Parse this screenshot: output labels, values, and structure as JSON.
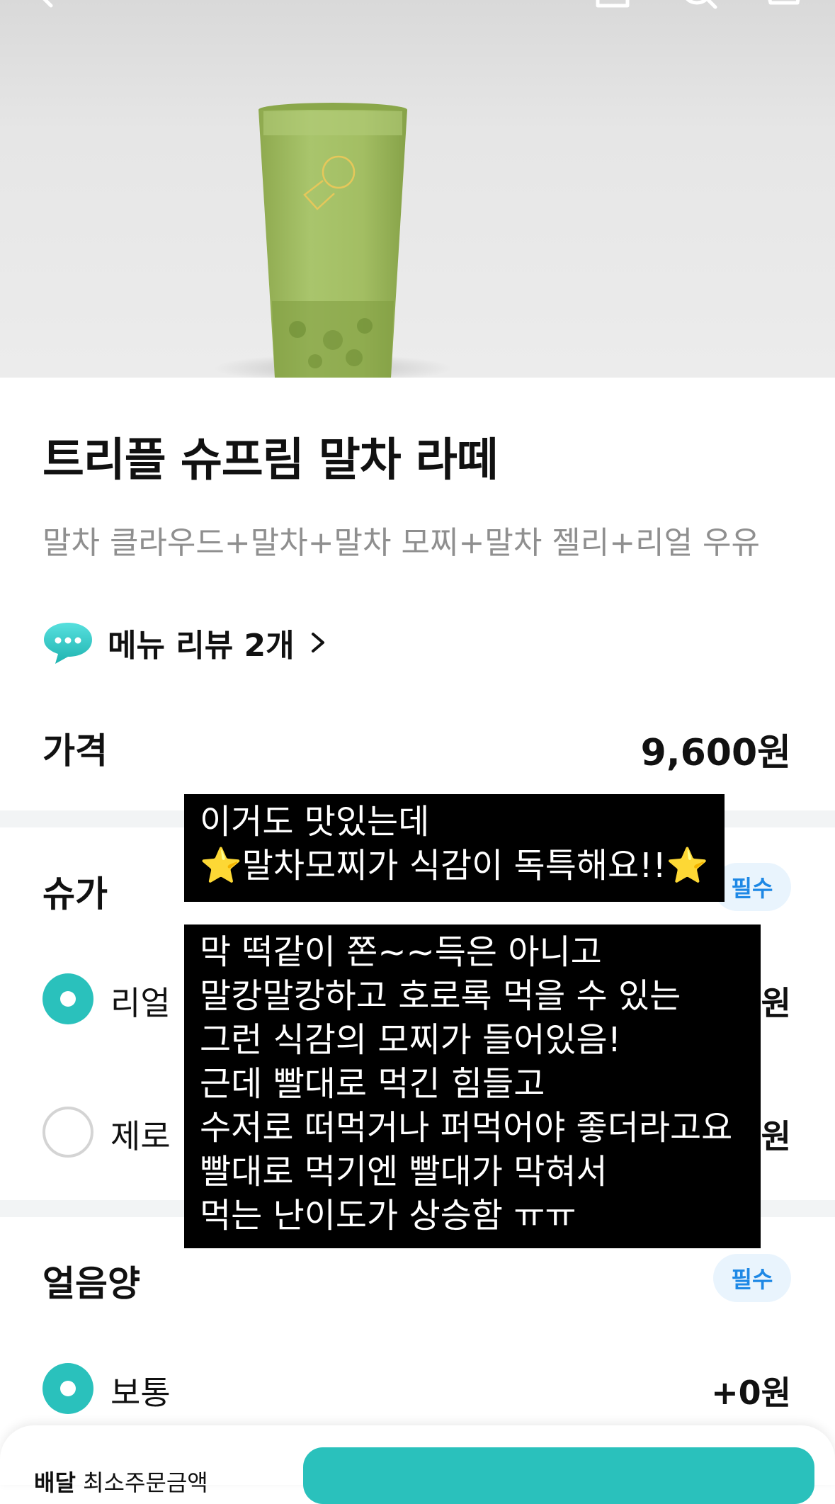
{
  "product": {
    "title": "트리플 슈프림 말차 라떼",
    "description": "말차 클라우드+말차+말차 모찌+말차 젤리+리얼 우유",
    "review_label": "메뉴 리뷰 2개"
  },
  "price": {
    "label": "가격",
    "value": "9,600원"
  },
  "sugar": {
    "title": "슈가",
    "badge": "필수",
    "options": [
      {
        "label": "리얼 ",
        "price": "원",
        "selected": true
      },
      {
        "label": "제로 ",
        "price": "원",
        "selected": false
      }
    ]
  },
  "ice": {
    "title": "얼음양",
    "badge": "필수",
    "options": [
      {
        "label": "보통",
        "price": "+0원",
        "selected": true
      }
    ]
  },
  "overlays": {
    "first": [
      "이거도 맛있는데",
      "⭐말차모찌가 식감이 독특해요!!⭐"
    ],
    "second": [
      "막 떡같이 쫀~~득은 아니고",
      "말캉말캉하고 호로록 먹을 수 있는",
      "그런 식감의 모찌가 들어있음!",
      "근데 빨대로 먹긴 힘들고",
      "수저로 떠먹거나 퍼먹어야 좋더라고요",
      "빨대로 먹기엔 빨대가 막혀서",
      "먹는 난이도가 상승함 ㅠㅠ"
    ]
  },
  "bottom": {
    "label_bold": "배달",
    "label_rest": " 최소주문금액"
  },
  "colors": {
    "accent": "#2ac1bc",
    "badge_bg": "#e9f4fd",
    "badge_text": "#1e88e5",
    "matcha": "#9fbd5c"
  },
  "icons": [
    "back-arrow-icon",
    "share-icon",
    "search-icon",
    "cart-icon",
    "speech-bubble-icon",
    "chevron-right-icon"
  ]
}
